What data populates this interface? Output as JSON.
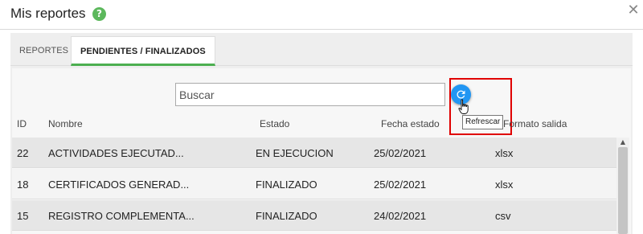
{
  "window": {
    "title": "Mis reportes",
    "help_icon": "?",
    "close_icon": "✕"
  },
  "tabs": [
    {
      "label": "REPORTES",
      "active": false
    },
    {
      "label": "PENDIENTES / FINALIZADOS",
      "active": true
    }
  ],
  "search": {
    "placeholder": "Buscar",
    "value": ""
  },
  "refresh": {
    "icon": "refresh-icon",
    "tooltip": "Refrescar"
  },
  "table": {
    "columns": [
      "ID",
      "Nombre",
      "Estado",
      "Fecha estado",
      "Formato salida"
    ],
    "rows": [
      {
        "id": "22",
        "nombre": "ACTIVIDADES EJECUTAD...",
        "estado": "EN EJECUCION",
        "fecha": "25/02/2021",
        "formato": "xlsx"
      },
      {
        "id": "18",
        "nombre": "CERTIFICADOS GENERAD...",
        "estado": "FINALIZADO",
        "fecha": "25/02/2021",
        "formato": "xlsx"
      },
      {
        "id": "15",
        "nombre": "REGISTRO COMPLEMENTA...",
        "estado": "FINALIZADO",
        "fecha": "24/02/2021",
        "formato": "csv"
      }
    ]
  },
  "colors": {
    "accent_green": "#4caf50",
    "help_green": "#5cb85c",
    "refresh_blue": "#2196f3",
    "highlight_red": "#e00000"
  }
}
